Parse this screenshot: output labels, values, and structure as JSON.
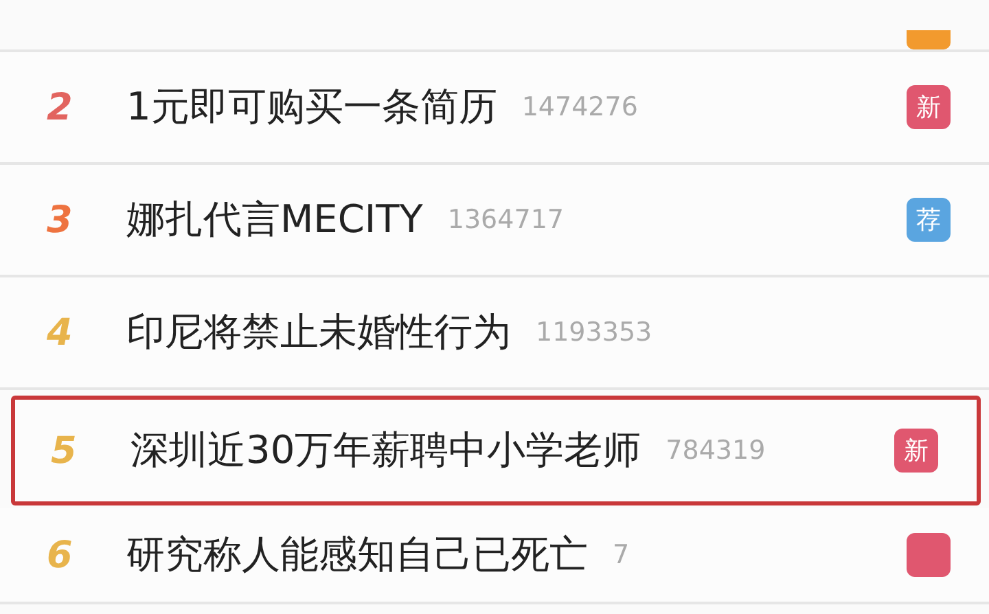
{
  "partial_row": {
    "badge": {
      "color": "#f29a2e"
    }
  },
  "rows": [
    {
      "rank": {
        "text": "2",
        "color": "#e2645f"
      },
      "title": "1元即可购买一条简历",
      "count": "1474276",
      "badge": {
        "label": "新",
        "color": "#e0576f"
      },
      "highlighted": false
    },
    {
      "rank": {
        "text": "3",
        "color": "#ee7340"
      },
      "title": "娜扎代言MECITY",
      "count": "1364717",
      "badge": {
        "label": "荐",
        "color": "#5aa5e0"
      },
      "highlighted": false
    },
    {
      "rank": {
        "text": "4",
        "color": "#e8b44c"
      },
      "title": "印尼将禁止未婚性行为",
      "count": "1193353",
      "highlighted": false
    },
    {
      "rank": {
        "text": "5",
        "color": "#e8b44c"
      },
      "title": "深圳近30万年薪聘中小学老师",
      "count": "784319",
      "badge": {
        "label": "新",
        "color": "#e0576f"
      },
      "highlighted": true
    },
    {
      "rank": {
        "text": "6",
        "color": "#e8b44c"
      },
      "title": "研究称人能感知自己已死亡",
      "count": "7",
      "badge": {
        "color": "#e0576f"
      },
      "highlighted": false
    }
  ]
}
